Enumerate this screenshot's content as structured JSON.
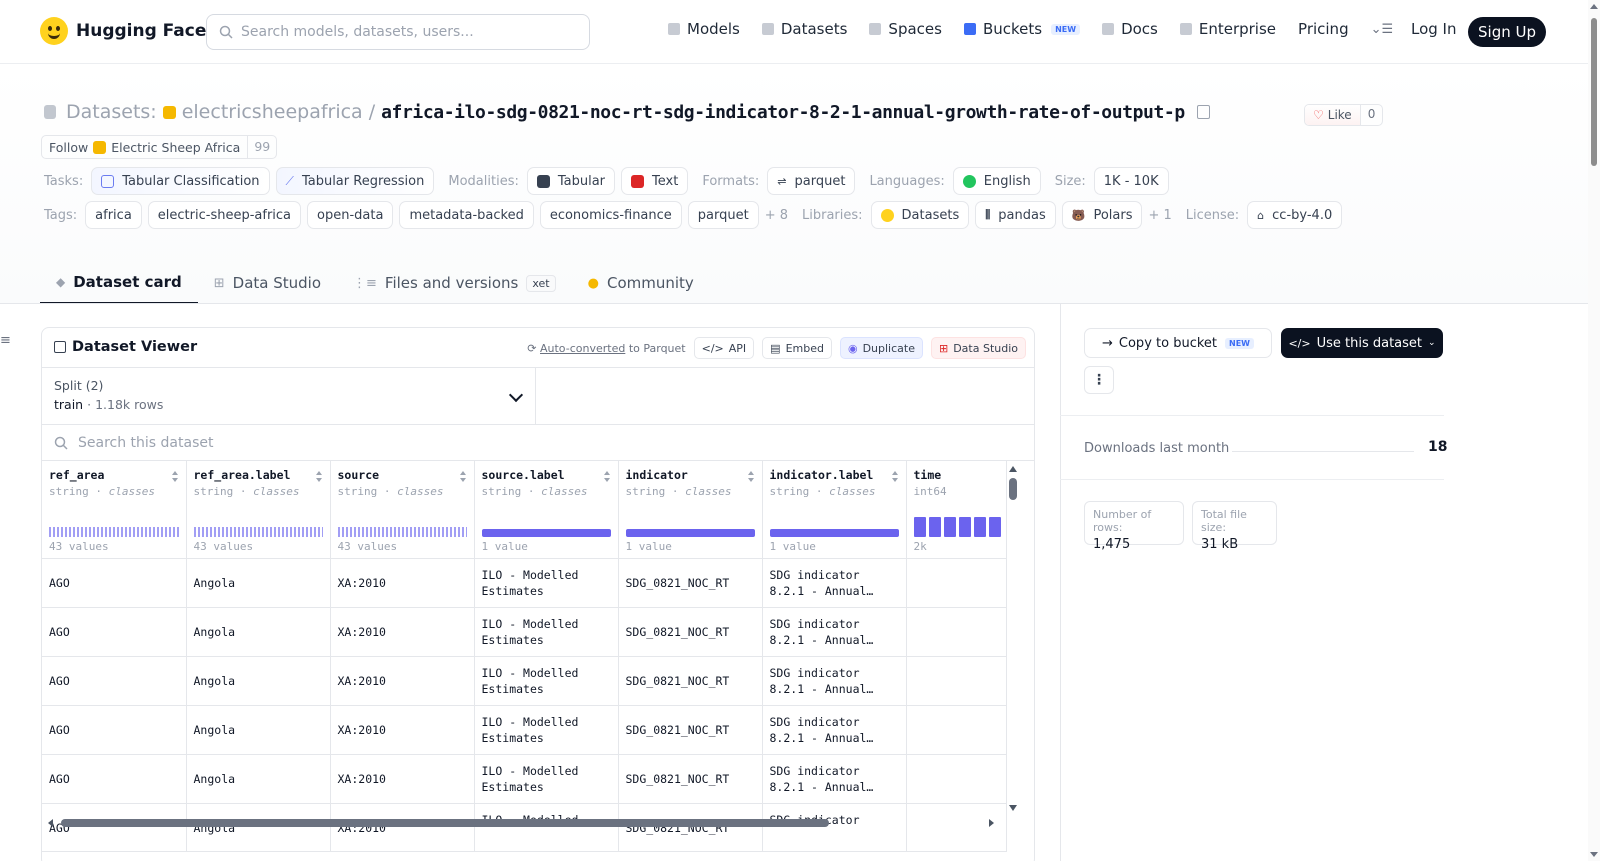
{
  "nav": {
    "brand": "Hugging Face",
    "search_placeholder": "Search models, datasets, users...",
    "items": [
      {
        "label": "Models",
        "icon": "cube-icon"
      },
      {
        "label": "Datasets",
        "icon": "database-icon"
      },
      {
        "label": "Spaces",
        "icon": "grid-icon"
      },
      {
        "label": "Buckets",
        "icon": "bucket-icon",
        "badge": "NEW"
      },
      {
        "label": "Docs",
        "icon": "book-icon"
      },
      {
        "label": "Enterprise",
        "icon": "enterprise-icon"
      },
      {
        "label": "Pricing"
      }
    ],
    "login": "Log In",
    "signup": "Sign Up"
  },
  "header": {
    "datasets_label": "Datasets:",
    "org": "electricsheepafrica",
    "slash": "/",
    "name": "africa-ilo-sdg-0821-noc-rt-sdg-indicator-8-2-1-annual-growth-rate-of-output-p",
    "like_label": "Like",
    "like_count": "0",
    "follow_label": "Follow",
    "follow_org": "Electric Sheep Africa",
    "follow_count": "99"
  },
  "meta_row1": {
    "tasks_label": "Tasks:",
    "tasks": [
      "Tabular Classification",
      "Tabular Regression"
    ],
    "modalities_label": "Modalities:",
    "modalities": [
      "Tabular",
      "Text"
    ],
    "formats_label": "Formats:",
    "formats": [
      "parquet"
    ],
    "languages_label": "Languages:",
    "languages": [
      "English"
    ],
    "size_label": "Size:",
    "size": "1K - 10K"
  },
  "meta_row2": {
    "tags_label": "Tags:",
    "tags": [
      "africa",
      "electric-sheep-africa",
      "open-data",
      "metadata-backed",
      "economics-finance",
      "parquet"
    ],
    "tags_more": "+ 8",
    "libraries_label": "Libraries:",
    "libraries": [
      "Datasets",
      "pandas",
      "Polars"
    ],
    "libraries_more": "+ 1",
    "license_label": "License:",
    "license": "cc-by-4.0"
  },
  "tabs": [
    {
      "label": "Dataset card",
      "active": true
    },
    {
      "label": "Data Studio"
    },
    {
      "label": "Files and versions",
      "badge": "xet"
    },
    {
      "label": "Community"
    }
  ],
  "viewer": {
    "title": "Dataset Viewer",
    "auto_converted": "Auto-converted",
    "to_parquet": " to Parquet",
    "api": "API",
    "embed": "Embed",
    "duplicate": "Duplicate",
    "data_studio": "Data Studio",
    "split_label": "Split (2)",
    "split_name": "train",
    "split_sep": "·",
    "split_rows": "1.18k rows",
    "search_placeholder": "Search this dataset",
    "columns": [
      {
        "name": "ref_area",
        "type": "string",
        "kind": "classes",
        "hist": "43 values"
      },
      {
        "name": "ref_area.label",
        "type": "string",
        "kind": "classes",
        "hist": "43 values"
      },
      {
        "name": "source",
        "type": "string",
        "kind": "classes",
        "hist": "43 values"
      },
      {
        "name": "source.label",
        "type": "string",
        "kind": "classes",
        "hist": "1 value"
      },
      {
        "name": "indicator",
        "type": "string",
        "kind": "classes",
        "hist": "1 value"
      },
      {
        "name": "indicator.label",
        "type": "string",
        "kind": "classes",
        "hist": "1 value"
      },
      {
        "name": "time",
        "type": "int64",
        "kind": "",
        "hist": "2k"
      }
    ],
    "rows": [
      [
        "AGO",
        "Angola",
        "XA:2010",
        "ILO - Modelled Estimates",
        "SDG_0821_NOC_RT",
        "SDG indicator 8.2.1 - Annual…",
        ""
      ],
      [
        "AGO",
        "Angola",
        "XA:2010",
        "ILO - Modelled Estimates",
        "SDG_0821_NOC_RT",
        "SDG indicator 8.2.1 - Annual…",
        ""
      ],
      [
        "AGO",
        "Angola",
        "XA:2010",
        "ILO - Modelled Estimates",
        "SDG_0821_NOC_RT",
        "SDG indicator 8.2.1 - Annual…",
        ""
      ],
      [
        "AGO",
        "Angola",
        "XA:2010",
        "ILO - Modelled Estimates",
        "SDG_0821_NOC_RT",
        "SDG indicator 8.2.1 - Annual…",
        ""
      ],
      [
        "AGO",
        "Angola",
        "XA:2010",
        "ILO - Modelled Estimates",
        "SDG_0821_NOC_RT",
        "SDG indicator 8.2.1 - Annual…",
        ""
      ],
      [
        "AGO",
        "Angola",
        "XA:2010",
        "ILO - Modelled",
        "SDG_0821_NOC_RT",
        "SDG indicator",
        ""
      ]
    ]
  },
  "sidebar": {
    "copy_bucket": "Copy to bucket",
    "copy_bucket_badge": "NEW",
    "use_dataset": "Use this dataset",
    "downloads_label": "Downloads last month",
    "downloads_value": "18",
    "rows_label": "Number of rows:",
    "rows_value": "1,475",
    "size_label": "Total file size:",
    "size_value": "31 kB"
  },
  "colors": {
    "accent": "#6b63ee",
    "dark_button": "#0b1220",
    "brand_yellow": "#ffd21e"
  }
}
